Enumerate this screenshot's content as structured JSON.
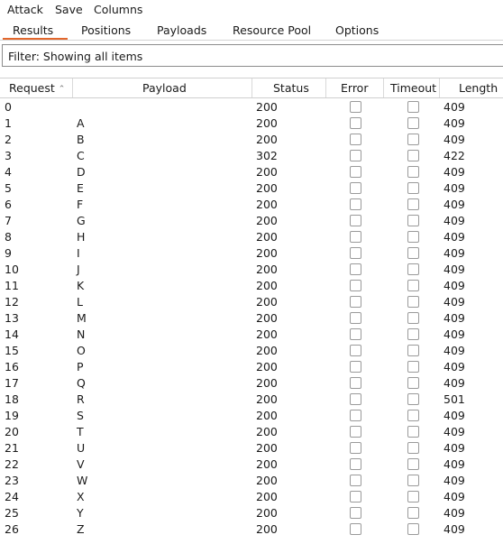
{
  "menu": {
    "attack": "Attack",
    "save": "Save",
    "columns": "Columns"
  },
  "tabs": [
    {
      "label": "Results",
      "active": true
    },
    {
      "label": "Positions"
    },
    {
      "label": "Payloads"
    },
    {
      "label": "Resource Pool"
    },
    {
      "label": "Options"
    }
  ],
  "filter": {
    "text": "Filter: Showing all items"
  },
  "columns": {
    "request": "Request",
    "request_sort_glyph": "⌃",
    "payload": "Payload",
    "status": "Status",
    "error": "Error",
    "timeout": "Timeout",
    "length": "Length"
  },
  "accent_color": "#e3672c",
  "rows": [
    {
      "request": "0",
      "payload": "",
      "status": "200",
      "error": false,
      "timeout": false,
      "length": "409"
    },
    {
      "request": "1",
      "payload": "A",
      "status": "200",
      "error": false,
      "timeout": false,
      "length": "409"
    },
    {
      "request": "2",
      "payload": "B",
      "status": "200",
      "error": false,
      "timeout": false,
      "length": "409"
    },
    {
      "request": "3",
      "payload": "C",
      "status": "302",
      "error": false,
      "timeout": false,
      "length": "422"
    },
    {
      "request": "4",
      "payload": "D",
      "status": "200",
      "error": false,
      "timeout": false,
      "length": "409"
    },
    {
      "request": "5",
      "payload": "E",
      "status": "200",
      "error": false,
      "timeout": false,
      "length": "409"
    },
    {
      "request": "6",
      "payload": "F",
      "status": "200",
      "error": false,
      "timeout": false,
      "length": "409"
    },
    {
      "request": "7",
      "payload": "G",
      "status": "200",
      "error": false,
      "timeout": false,
      "length": "409"
    },
    {
      "request": "8",
      "payload": "H",
      "status": "200",
      "error": false,
      "timeout": false,
      "length": "409"
    },
    {
      "request": "9",
      "payload": "I",
      "status": "200",
      "error": false,
      "timeout": false,
      "length": "409"
    },
    {
      "request": "10",
      "payload": "J",
      "status": "200",
      "error": false,
      "timeout": false,
      "length": "409"
    },
    {
      "request": "11",
      "payload": "K",
      "status": "200",
      "error": false,
      "timeout": false,
      "length": "409"
    },
    {
      "request": "12",
      "payload": "L",
      "status": "200",
      "error": false,
      "timeout": false,
      "length": "409"
    },
    {
      "request": "13",
      "payload": "M",
      "status": "200",
      "error": false,
      "timeout": false,
      "length": "409"
    },
    {
      "request": "14",
      "payload": "N",
      "status": "200",
      "error": false,
      "timeout": false,
      "length": "409"
    },
    {
      "request": "15",
      "payload": "O",
      "status": "200",
      "error": false,
      "timeout": false,
      "length": "409"
    },
    {
      "request": "16",
      "payload": "P",
      "status": "200",
      "error": false,
      "timeout": false,
      "length": "409"
    },
    {
      "request": "17",
      "payload": "Q",
      "status": "200",
      "error": false,
      "timeout": false,
      "length": "409"
    },
    {
      "request": "18",
      "payload": "R",
      "status": "200",
      "error": false,
      "timeout": false,
      "length": "501"
    },
    {
      "request": "19",
      "payload": "S",
      "status": "200",
      "error": false,
      "timeout": false,
      "length": "409"
    },
    {
      "request": "20",
      "payload": "T",
      "status": "200",
      "error": false,
      "timeout": false,
      "length": "409"
    },
    {
      "request": "21",
      "payload": "U",
      "status": "200",
      "error": false,
      "timeout": false,
      "length": "409"
    },
    {
      "request": "22",
      "payload": "V",
      "status": "200",
      "error": false,
      "timeout": false,
      "length": "409"
    },
    {
      "request": "23",
      "payload": "W",
      "status": "200",
      "error": false,
      "timeout": false,
      "length": "409"
    },
    {
      "request": "24",
      "payload": "X",
      "status": "200",
      "error": false,
      "timeout": false,
      "length": "409"
    },
    {
      "request": "25",
      "payload": "Y",
      "status": "200",
      "error": false,
      "timeout": false,
      "length": "409"
    },
    {
      "request": "26",
      "payload": "Z",
      "status": "200",
      "error": false,
      "timeout": false,
      "length": "409"
    }
  ]
}
